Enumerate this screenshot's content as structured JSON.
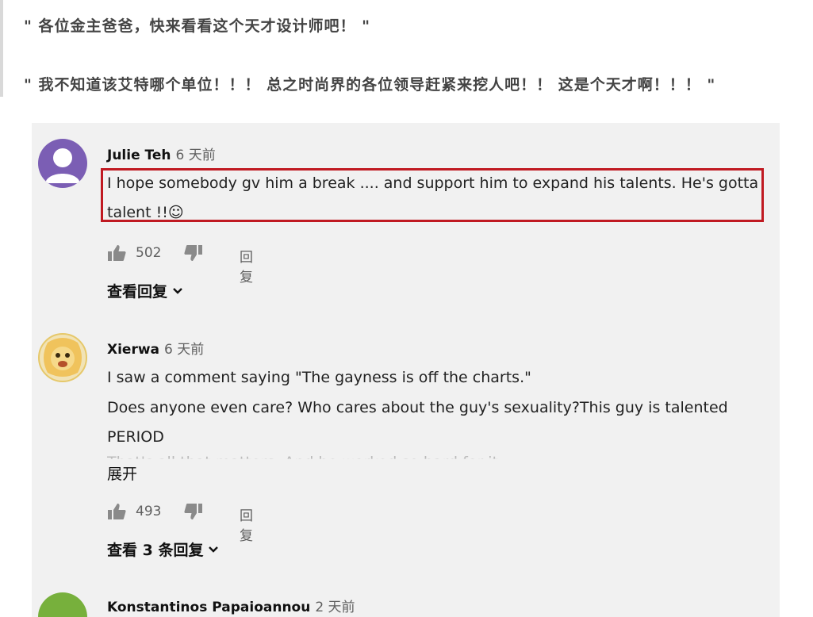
{
  "article": {
    "quote1": "\" 各位金主爸爸，快来看看这个天才设计师吧！ \"",
    "quote2": "\" 我不知道该艾特哪个单位！！！ 总之时尚界的各位领导赶紧来挖人吧！！ 这是个天才啊！！！ \""
  },
  "comments": [
    {
      "author": "Julie Teh",
      "time": "6 天前",
      "text_line1": "I hope somebody gv him a break .... and support him to expand his talents. He's gotta",
      "text_line2": "talent !!☺",
      "likes": "502",
      "reply_label": "回复",
      "view_replies": "查看回复",
      "highlighted": true
    },
    {
      "author": "Xierwa",
      "time": "6 天前",
      "text_line1": "I saw a comment saying \"The gayness is off the charts.\"",
      "text_line2": "Does anyone even care? Who cares about the guy's sexuality?This guy is talented",
      "text_line3": "PERIOD",
      "text_line4": "That's all that matters. And he worked so hard for it",
      "expand_label": "展开",
      "likes": "493",
      "reply_label": "回复",
      "view_replies": "查看 3 条回复"
    },
    {
      "author": "Konstantinos Papaioannou",
      "time": "2 天前"
    }
  ],
  "colors": {
    "highlight_border": "#c01a22",
    "panel_bg": "#f1f1f1",
    "avatar_purple": "#7b5eb4",
    "avatar_green": "#77b03c"
  },
  "icons": [
    "person-icon",
    "thumbs-up-icon",
    "thumbs-down-icon",
    "chevron-down-icon"
  ]
}
